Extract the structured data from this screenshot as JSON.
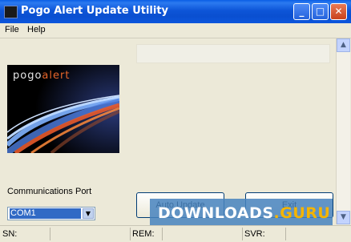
{
  "window": {
    "title": "Pogo Alert Update Utility"
  },
  "caption_buttons": {
    "minimize": "_",
    "maximize": "□",
    "close": "✕"
  },
  "menu": {
    "items": [
      {
        "label": "File"
      },
      {
        "label": "Help"
      }
    ]
  },
  "logo": {
    "brand_part1": "pogo",
    "brand_part2": "alert"
  },
  "port": {
    "label": "Communications Port",
    "selected": "COM1"
  },
  "buttons": {
    "auto_update": "Auto Update",
    "exit": "Exit"
  },
  "status": {
    "sn_label": "SN:",
    "rem_label": "REM:",
    "svr_label": "SVR:"
  },
  "watermark": {
    "text_part1": "DOWNLOADS",
    "text_part2": ".GURU"
  },
  "colors": {
    "titlebar": "#0a5ee6",
    "window_bg": "#ece9d8",
    "selection": "#316ac5",
    "logo_accent": "#e8662a"
  }
}
